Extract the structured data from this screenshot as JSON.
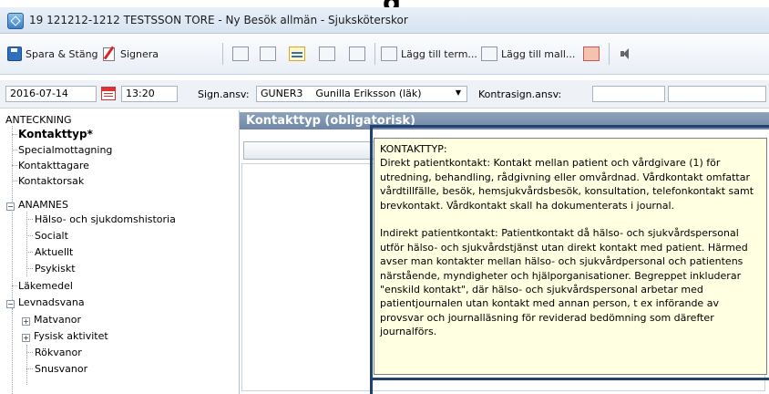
{
  "overlay_title": "g",
  "window": {
    "title": "19 121212-1212 TESTSSON TORE - Ny Besök allmän - Sjuksköterskor"
  },
  "toolbar": {
    "save_close_label": "Spara & Stäng",
    "sign_label": "Signera",
    "add_term_label": "Lägg till term...",
    "add_template_label": "Lägg till mall..."
  },
  "datebar": {
    "date": "2016-07-14",
    "time": "13:20",
    "sign_resp_label": "Sign.ansv:",
    "sign_resp_code": "GUNER3",
    "sign_resp_name": "Gunilla Eriksson (läk)",
    "countersign_label": "Kontrasign.ansv:"
  },
  "tree": {
    "root": "ANTECKNING",
    "items": [
      {
        "label": "Kontakttyp*"
      },
      {
        "label": "Specialmottagning"
      },
      {
        "label": "Kontakttagare"
      },
      {
        "label": "Kontaktorsak"
      },
      {
        "label": "ANAMNES"
      },
      {
        "label": "Hälso- och sjukdomshistoria"
      },
      {
        "label": "Socialt"
      },
      {
        "label": "Aktuellt"
      },
      {
        "label": "Psykiskt"
      },
      {
        "label": "Läkemedel"
      },
      {
        "label": "Levnadsvana"
      },
      {
        "label": "Matvanor"
      },
      {
        "label": "Fysisk aktivitet"
      },
      {
        "label": "Rökvanor"
      },
      {
        "label": "Snusvanor"
      }
    ]
  },
  "content": {
    "section_title": "Kontakttyp  (obligatorisk)"
  },
  "tooltip": {
    "heading": "KONTAKTTYP:",
    "para1": "Direkt patientkontakt: Kontakt mellan patient och vårdgivare (1) för utredning, behandling, rådgivning eller omvårdnad. Vårdkontakt omfattar vårdtillfälle, besök, hemsjukvårdsbesök, konsultation, telefonkontakt samt brevkontakt. Vårdkontakt skall ha dokumenterats i journal.",
    "para2": "Indirekt patientkontakt: Patientkontakt då hälso- och sjukvårdspersonal utför hälso- och sjukvårdstjänst utan direkt kontakt med patient. Härmed avser man kontakter mellan hälso- och sjukvårdpersonal och patientens närstående, myndigheter och hjälporganisationer. Begreppet inkluderar \"enskild kontakt\", där hälso- och sjukvårdspersonal arbetar med patientjournalen utan kontakt med annan person, t ex införande av provsvar och journalläsning för reviderad bedömning som därefter journalförs."
  }
}
